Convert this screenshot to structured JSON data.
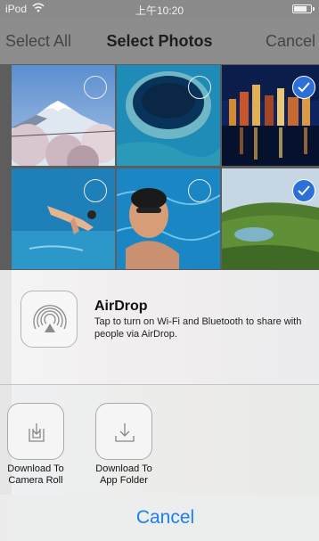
{
  "status_bar": {
    "carrier": "iPod",
    "time": "上午10:20"
  },
  "nav": {
    "left_label": "Select All",
    "title": "Select Photos",
    "right_label": "Cancel"
  },
  "photos": [
    {
      "subject": "mountain with cherry blossoms",
      "selected": false
    },
    {
      "subject": "blue hole in ocean",
      "selected": false
    },
    {
      "subject": "city lights at night",
      "selected": true
    },
    {
      "subject": "diver over pool",
      "selected": false
    },
    {
      "subject": "swimmer in pool",
      "selected": false
    },
    {
      "subject": "green hills with lake",
      "selected": true
    }
  ],
  "airdrop": {
    "title": "AirDrop",
    "description": "Tap to turn on Wi-Fi and Bluetooth to share with people via AirDrop."
  },
  "actions": [
    {
      "icon": "download-tray-icon",
      "label": "Download To Camera Roll"
    },
    {
      "icon": "download-arrow-icon",
      "label": "Download To App Folder"
    }
  ],
  "cancel_label": "Cancel",
  "colors": {
    "accent": "#1f7ef7",
    "selected_check": "#2d6fd8"
  }
}
